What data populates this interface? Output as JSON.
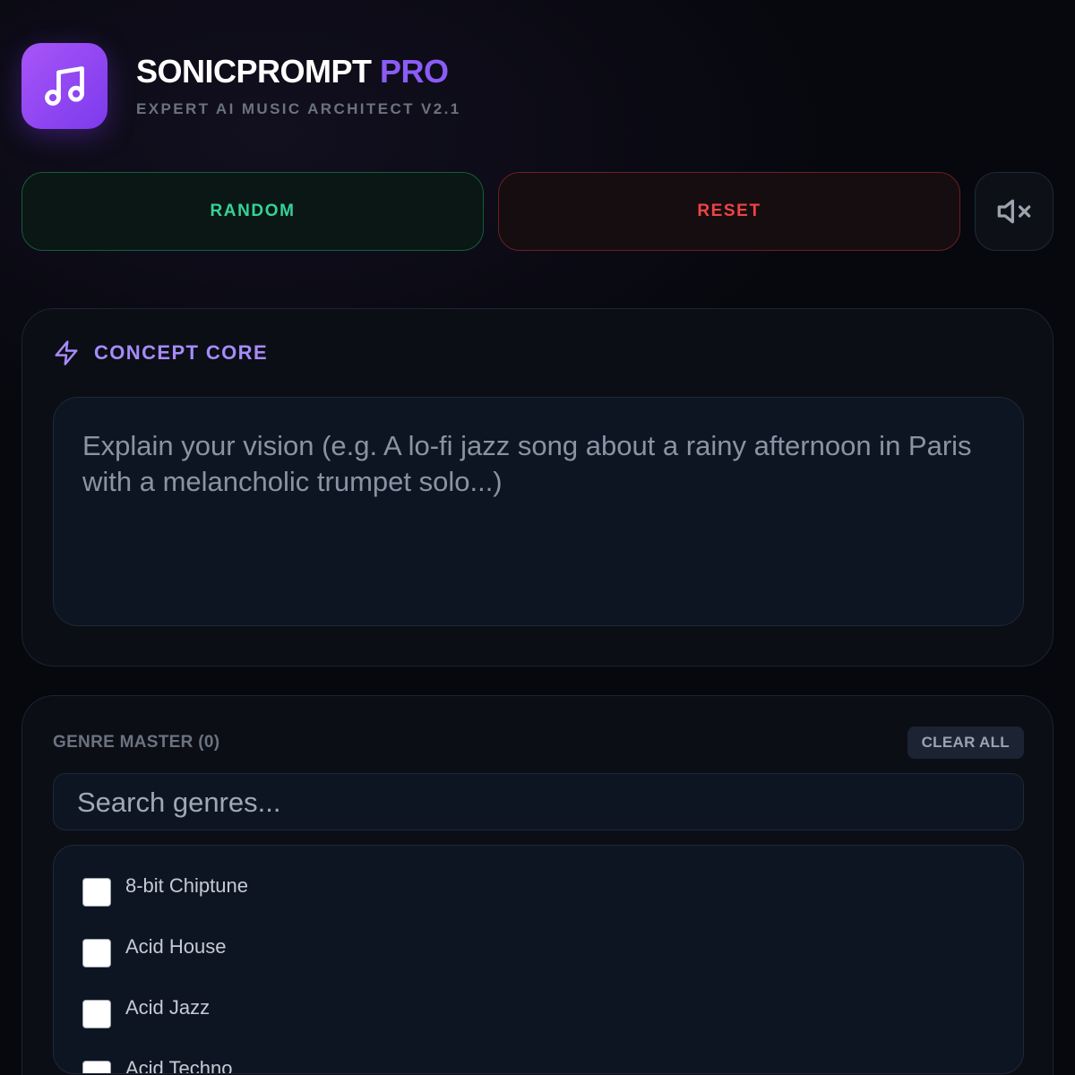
{
  "header": {
    "title_main": "SONICPROMPT",
    "title_accent": "PRO",
    "subtitle": "EXPERT AI MUSIC ARCHITECT V2.1",
    "logo_icon": "music-note-icon"
  },
  "actions": {
    "random_label": "RANDOM",
    "reset_label": "RESET",
    "mute_icon": "speaker-mute-icon"
  },
  "concept": {
    "icon": "lightning-icon",
    "title": "CONCEPT CORE",
    "placeholder": "Explain your vision (e.g. A lo-fi jazz song about a rainy afternoon in Paris with a melancholic trumpet solo...)"
  },
  "genre": {
    "title": "GENRE MASTER (0)",
    "clear_label": "CLEAR ALL",
    "search_placeholder": "Search genres...",
    "items": [
      {
        "label": "8-bit Chiptune"
      },
      {
        "label": "Acid House"
      },
      {
        "label": "Acid Jazz"
      },
      {
        "label": "Acid Techno"
      }
    ]
  },
  "colors": {
    "accent": "#8b5cf6",
    "random": "#34d399",
    "reset": "#ef4444"
  }
}
